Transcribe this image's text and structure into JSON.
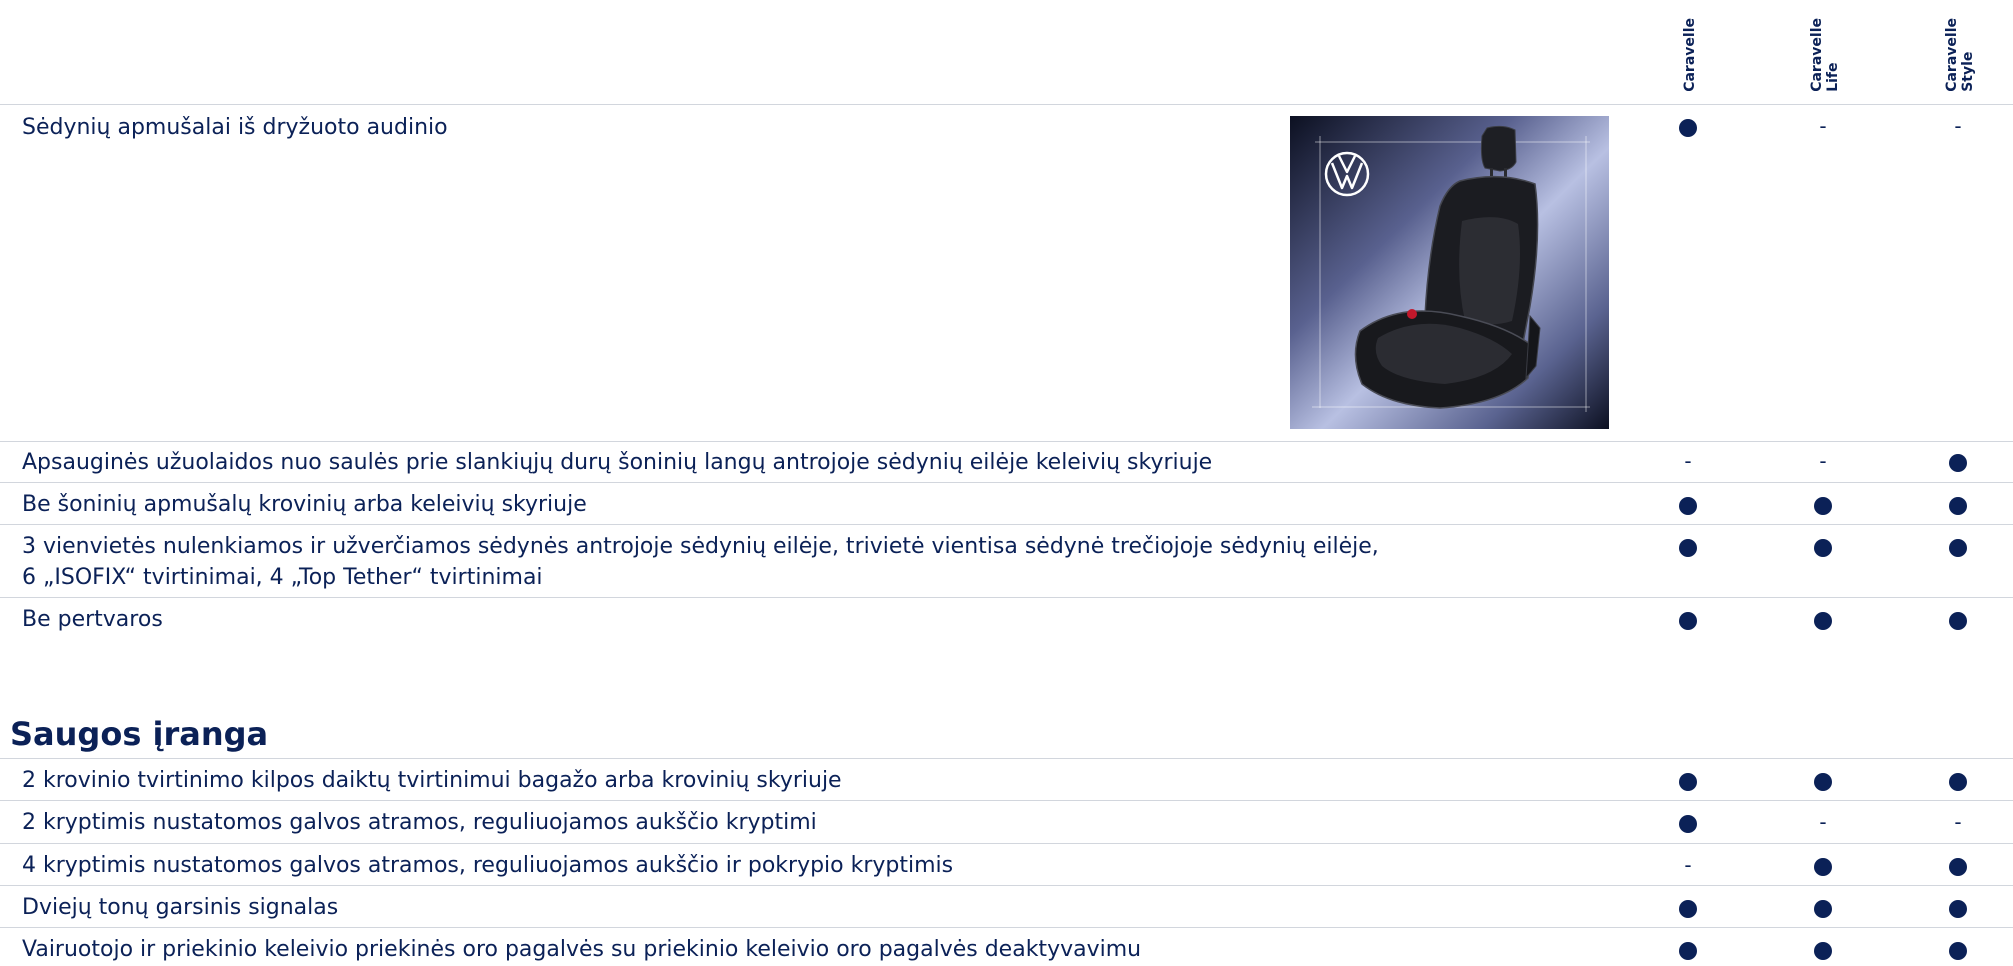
{
  "columns": [
    {
      "label": "Caravelle"
    },
    {
      "label": "Caravelle\nLife"
    },
    {
      "label": "Caravelle\nStyle"
    }
  ],
  "rows_top": [
    {
      "text": "Sėdynių apmušalai iš dryžuoto audinio",
      "values": [
        "●",
        "-",
        "-"
      ]
    },
    {
      "text": "Apsauginės užuolaidos nuo saulės prie slankiųjų durų šoninių langų antrojoje sėdynių eilėje keleivių skyriuje",
      "values": [
        "-",
        "-",
        "●"
      ]
    },
    {
      "text": "Be šoninių apmušalų krovinių arba keleivių skyriuje",
      "values": [
        "●",
        "●",
        "●"
      ]
    },
    {
      "text": "3 vienvietės nulenkiamos ir užverčiamos sėdynės antrojoje sėdynių eilėje, trivietė vientisa sėdynė trečiojoje sėdynių eilėje,",
      "text2": "6 „ISOFIX“ tvirtinimai, 4 „Top Tether“ tvirtinimai",
      "values": [
        "●",
        "●",
        "●"
      ]
    },
    {
      "text": "Be pertvaros",
      "values": [
        "●",
        "●",
        "●"
      ]
    }
  ],
  "section": {
    "title": "Saugos įranga"
  },
  "rows_safety": [
    {
      "text": "2 krovinio tvirtinimo kilpos daiktų tvirtinimui bagažo arba krovinių skyriuje",
      "values": [
        "●",
        "●",
        "●"
      ]
    },
    {
      "text": "2 kryptimis nustatomos galvos atramos, reguliuojamos aukščio kryptimi",
      "values": [
        "●",
        "-",
        "-"
      ]
    },
    {
      "text": "4 kryptimis nustatomos galvos atramos, reguliuojamos aukščio ir pokrypio kryptimis",
      "values": [
        "-",
        "●",
        "●"
      ]
    },
    {
      "text": "Dviejų tonų garsinis signalas",
      "values": [
        "●",
        "●",
        "●"
      ]
    },
    {
      "text": "Vairuotojo ir priekinio keleivio priekinės oro pagalvės su priekinio keleivio oro pagalvės deaktyvavimu",
      "values": [
        "●",
        "●",
        "●"
      ]
    }
  ],
  "image": {
    "subject": "seat-with-striped-fabric",
    "logo": "VW"
  },
  "colors": {
    "text": "#0b2157",
    "divider": "#d2d6dd"
  }
}
